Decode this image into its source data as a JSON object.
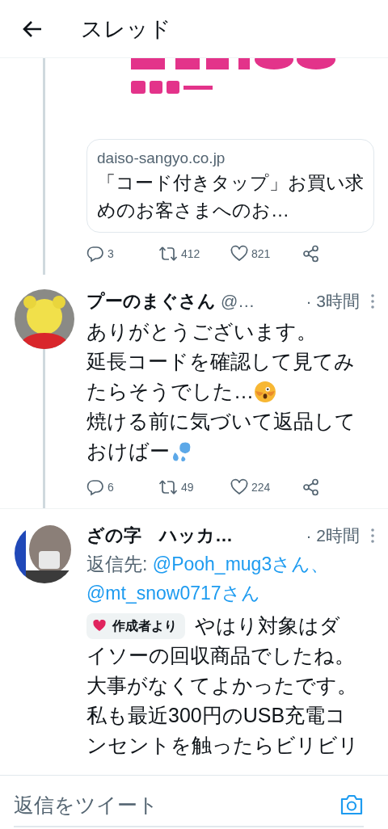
{
  "header": {
    "title": "スレッド"
  },
  "parent_tweet": {
    "link_card": {
      "domain": "daiso-sangyo.co.jp",
      "title": "「コード付きタップ」お買い求めのお客さまへのお…"
    },
    "actions": {
      "replies": "3",
      "retweets": "412",
      "likes": "821"
    }
  },
  "replies": [
    {
      "name": "プーのまぐさん",
      "handle": "@…",
      "time": "· 3時間",
      "thread_line": true,
      "body": [
        [
          {
            "kind": "text",
            "text": "ありがとうございます。"
          }
        ],
        [
          {
            "kind": "text",
            "text": "延長コードを確認して見てみ"
          }
        ],
        [
          {
            "kind": "text",
            "text": "たらそうでした…"
          },
          {
            "kind": "face"
          }
        ],
        [
          {
            "kind": "text",
            "text": "焼ける前に気づいて返品して"
          }
        ],
        [
          {
            "kind": "text",
            "text": "おけばー"
          },
          {
            "kind": "drops"
          }
        ]
      ],
      "actions": {
        "replies": "6",
        "retweets": "49",
        "likes": "224"
      }
    },
    {
      "name": "ざの字　ハッカ…",
      "time": "· 2時間",
      "thread_line": false,
      "reply_to": {
        "label": "返信先: ",
        "mentions": [
          "@Pooh_mug3さん、",
          "@mt_snow0717さん"
        ]
      },
      "badge": "作成者より",
      "body": [
        [
          {
            "kind": "text",
            "text": "やはり対象はダ"
          }
        ],
        [
          {
            "kind": "text",
            "text": "イソーの回収商品でしたね。"
          }
        ],
        [
          {
            "kind": "text",
            "text": "大事がなくてよかったです。"
          }
        ],
        [
          {
            "kind": "text",
            "text": "私も最近300円のUSB充電コ"
          }
        ],
        [
          {
            "kind": "text",
            "text": "ンセントを触ったらビリビリ"
          }
        ]
      ]
    }
  ],
  "reply_bar": {
    "placeholder": "返信をツイート"
  }
}
